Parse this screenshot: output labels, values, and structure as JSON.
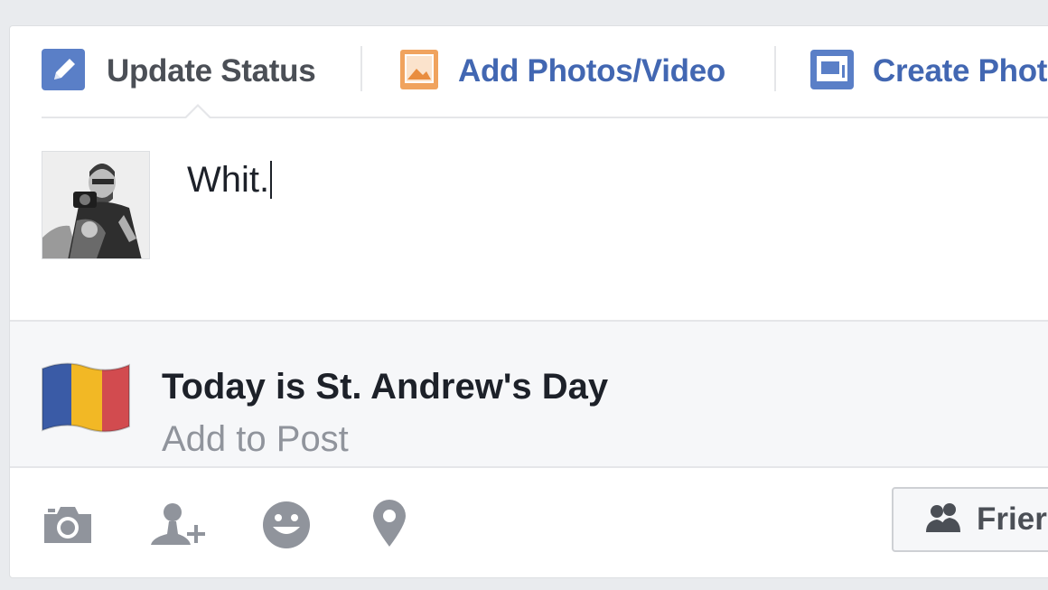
{
  "tabs": [
    {
      "label": "Update Status",
      "icon": "pencil-icon"
    },
    {
      "label": "Add Photos/Video",
      "icon": "photo-icon"
    },
    {
      "label": "Create Phot",
      "icon": "photo-album-icon"
    }
  ],
  "composer": {
    "text": "Whit."
  },
  "event": {
    "title": "Today is St. Andrew's Day",
    "action": "Add to Post",
    "icon": "romanian-flag-icon"
  },
  "toolbar": {
    "icons": [
      "camera-icon",
      "tag-friends-icon",
      "feeling-icon",
      "location-pin-icon"
    ],
    "audience_label": "Frier"
  },
  "colors": {
    "link_blue": "#4267b2",
    "icon_gray": "#90949c",
    "flag_blue": "#3a5ba6",
    "flag_yellow": "#f2b825",
    "flag_red": "#d24b4f"
  }
}
